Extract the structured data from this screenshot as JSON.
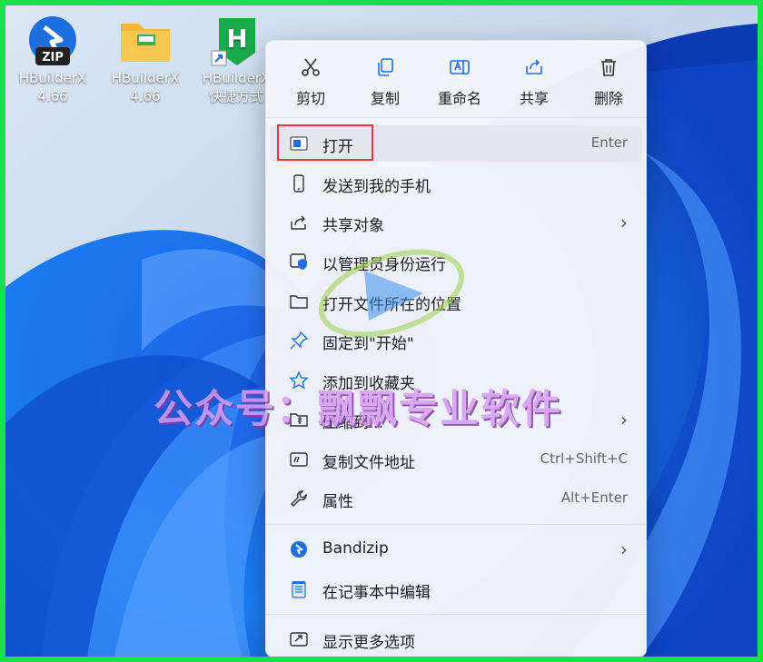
{
  "desktop": {
    "icons": [
      {
        "name": "HBuilderX",
        "sub": "4.66",
        "badge": "ZIP"
      },
      {
        "name": "HBuilderX",
        "sub": "4.66"
      },
      {
        "name": "HBuilderX",
        "sub": "快捷方式",
        "letter": "H"
      }
    ]
  },
  "context_menu": {
    "top_actions": [
      {
        "label": "剪切",
        "icon": "scissors-icon"
      },
      {
        "label": "复制",
        "icon": "copy-icon"
      },
      {
        "label": "重命名",
        "icon": "rename-icon"
      },
      {
        "label": "共享",
        "icon": "share-icon"
      },
      {
        "label": "删除",
        "icon": "trash-icon"
      }
    ],
    "items": [
      {
        "label": "打开",
        "shortcut": "Enter",
        "icon": "app-window-icon"
      },
      {
        "label": "发送到我的手机",
        "icon": "phone-icon"
      },
      {
        "label": "共享对象",
        "icon": "share-object-icon"
      },
      {
        "label": "以管理员身份运行",
        "icon": "shield-icon"
      },
      {
        "label": "打开文件所在的位置",
        "icon": "folder-icon"
      },
      {
        "label": "固定到\"开始\"",
        "icon": "pin-icon"
      },
      {
        "label": "添加到收藏夹",
        "icon": "star-icon"
      },
      {
        "label": "压缩到...",
        "icon": "zip-folder-icon"
      },
      {
        "label": "复制文件地址",
        "shortcut": "Ctrl+Shift+C",
        "icon": "copy-path-icon"
      },
      {
        "label": "属性",
        "shortcut": "Alt+Enter",
        "icon": "wrench-icon"
      },
      {
        "label": "Bandizip",
        "icon": "bandizip-icon"
      },
      {
        "label": "在记事本中编辑",
        "icon": "notepad-icon"
      },
      {
        "label": "显示更多选项",
        "icon": "more-options-icon"
      }
    ]
  },
  "watermark": {
    "text": "公众号：飘飘专业软件"
  },
  "colors": {
    "frame": "#18e24a",
    "highlight_box": "#e23d3d",
    "accent": "#1f6fe0"
  }
}
